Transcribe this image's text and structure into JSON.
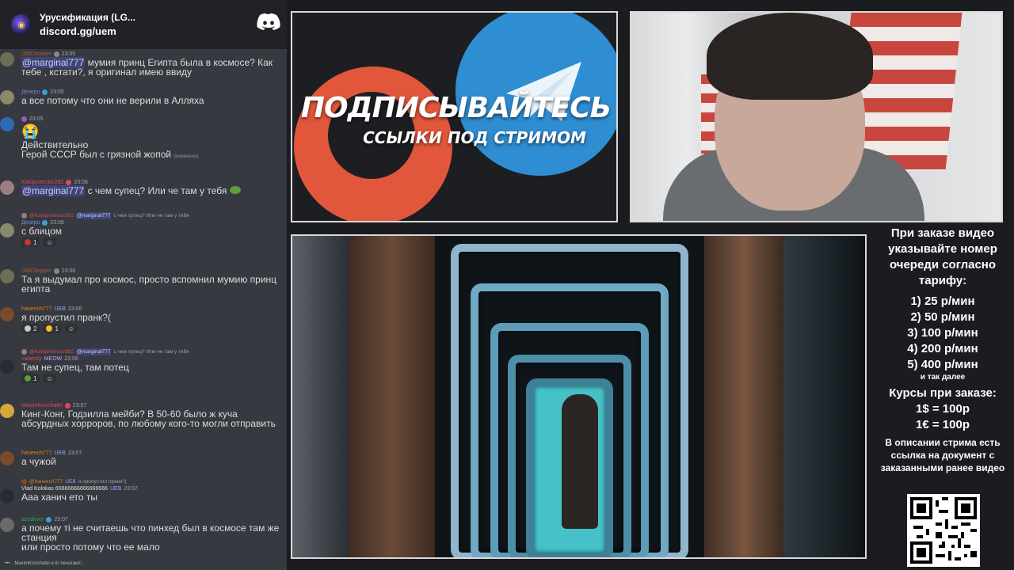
{
  "chat": {
    "server_name": "Урусификация (LG...",
    "server_link": "discord.gg/uem",
    "messages": [
      {
        "author": "OldChopper",
        "author_color": "#b05a3c",
        "time": "23:05",
        "text_mention": "@marginal777",
        "text": " мумия принц Египта была в космосе? Как тебе , кстати?, я оригинал имею ввиду"
      },
      {
        "author": "Дезеро",
        "author_color": "#7289da",
        "time": "23:05",
        "text": "а все потому что они не верили в Алляха"
      },
      {
        "author": "",
        "author_color": "#9b59b6",
        "time": "23:05",
        "emoji": "😭",
        "text": "Действительно",
        "text2": "Герой СССР был с грязной жопой",
        "edited": "(изменено)"
      },
      {
        "author": "Kaloprotector282",
        "author_color": "#e0465c",
        "time": "23:06",
        "text_mention": "@marginal777",
        "text": " с чем супец? Или че там у тебя"
      },
      {
        "reply_author": "@Kaloprotector282",
        "reply_mention": "@marginal777",
        "reply_text": "с чем супец? Или че там у тебя",
        "author": "Дезеро",
        "author_color": "#7289da",
        "time": "23:06",
        "text": "с блицом",
        "reaction_count": "1"
      },
      {
        "author": "OldChopper",
        "author_color": "#b05a3c",
        "time": "23:06",
        "text": "Та я выдумал про космос, просто вспомнил мумию принц египта"
      },
      {
        "author": "haneech777",
        "author_color": "#e67e22",
        "tag": "UEB",
        "time": "23:06",
        "text": "я пропустил пранк?(",
        "reactions": [
          "2",
          "1"
        ]
      },
      {
        "reply_author": "@Kaloprotector282",
        "reply_mention": "@marginal777",
        "reply_text": "с чем супец? Или че там у тебя",
        "author": "calamity",
        "author_color": "#e0465c",
        "tag": "MEOW",
        "time": "23:06",
        "text": "Там не супец, там потец",
        "reaction_count": "1"
      },
      {
        "author": "MaximKonchatel",
        "author_color": "#e0465c",
        "time": "23:07",
        "text": "Кинг-Конг, Годзилла мейби? В 50-60 было ж куча абсурдных хорроров, по любому кого-то могли отправить"
      },
      {
        "author": "haneech777",
        "author_color": "#e67e22",
        "tag": "UEB",
        "time": "23:07",
        "text": "а чужой"
      },
      {
        "reply_author": "@haneech777",
        "reply_tag": "UEB",
        "reply_text": "я пропустил пранк?(",
        "author": "Vlad Kolokas 66666666666666666",
        "author_color": "#e0e0e0",
        "tag": "UEB",
        "time": "23:07",
        "text": "Ааа ханич ето ты"
      },
      {
        "author": "assdriver",
        "author_color": "#3ba55d",
        "time": "23:07",
        "text": "а почему ті не считаешь что пинхед был в космосе там же станция",
        "text2": "или просто потому что ее мало"
      }
    ],
    "typing": "MaximKonchatel и ёr печатают..."
  },
  "banner": {
    "title": "ПОДПИСЫВАЙТЕСЬ",
    "subtitle": "ССЫЛКИ ПОД СТРИМОМ",
    "patreon_color": "#e2573b",
    "telegram_color": "#2f8ed2"
  },
  "info": {
    "heading": "При заказе видео указывайте номер очереди согласно тарифу:",
    "tariffs": [
      "1) 25 р/мин",
      "2) 50 р/мин",
      "3) 100 р/мин",
      "4) 200 р/мин",
      "5) 400 р/мин"
    ],
    "tariff_note": "и так далее",
    "rates_heading": "Курсы при заказе:",
    "rates": [
      "1$ = 100р",
      "1€ = 100р"
    ],
    "description": "В описании стрима есть ссылка на документ с заказанными ранее видео"
  }
}
